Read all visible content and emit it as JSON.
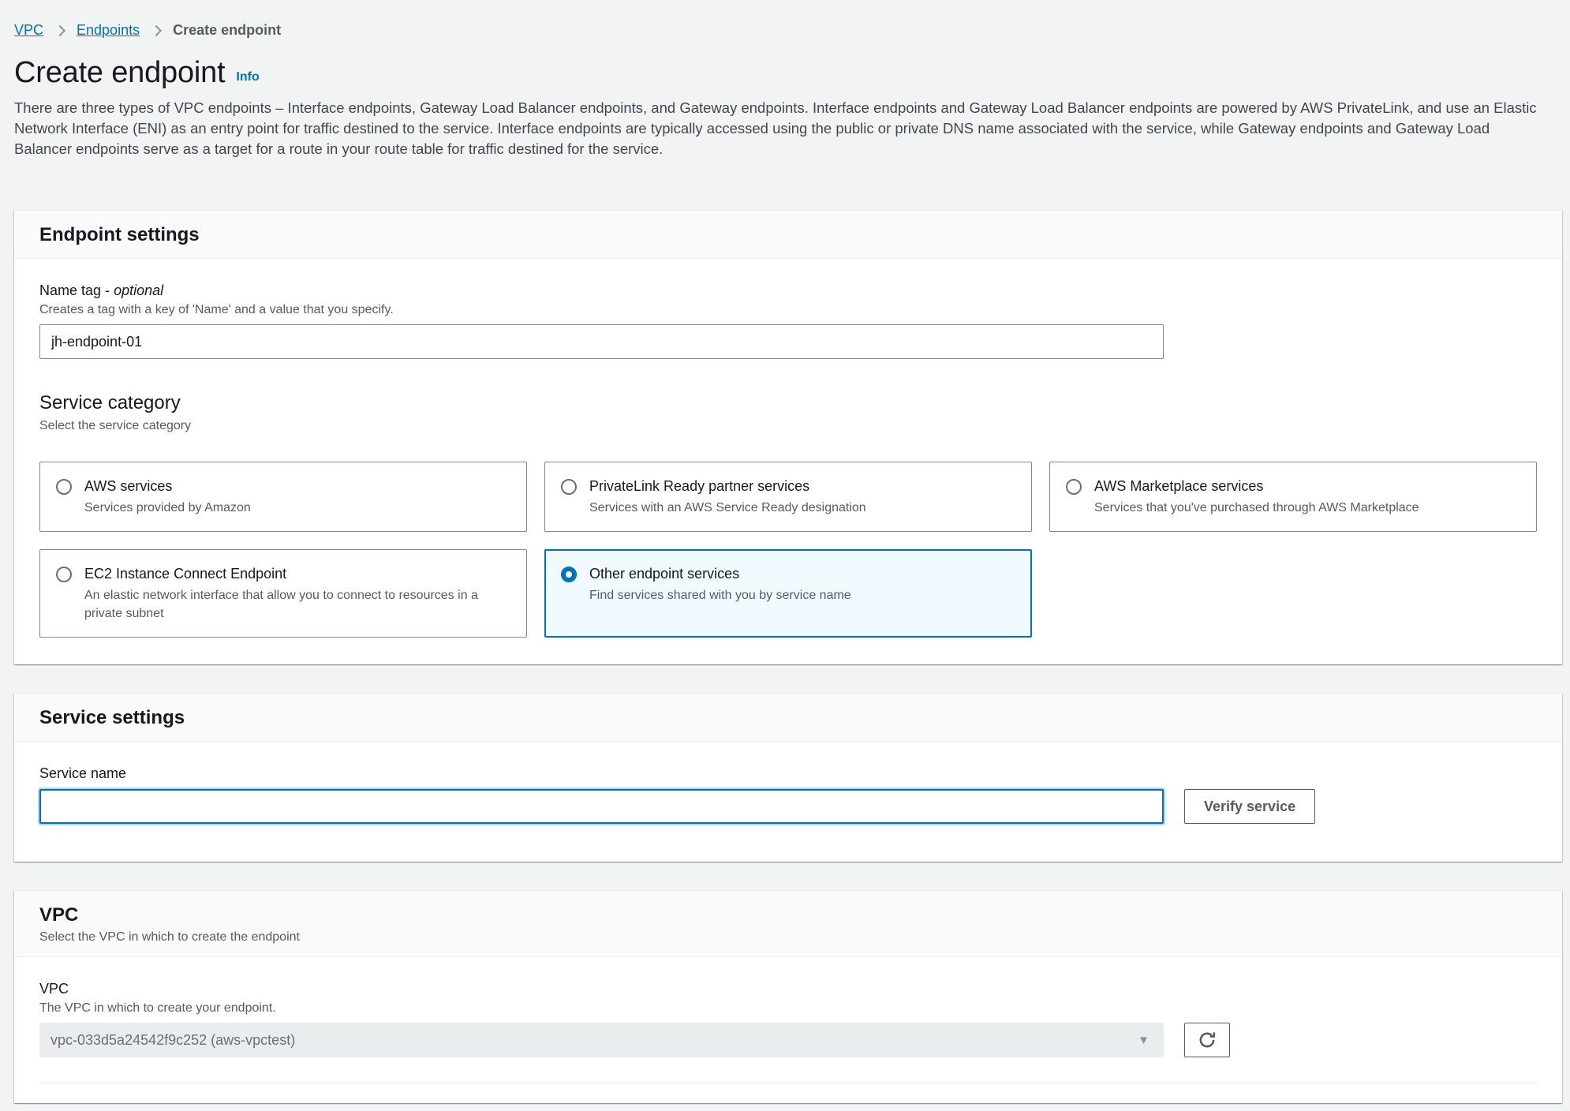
{
  "breadcrumb": {
    "items": [
      "VPC",
      "Endpoints",
      "Create endpoint"
    ]
  },
  "header": {
    "title": "Create endpoint",
    "info_link": "Info",
    "description": "There are three types of VPC endpoints – Interface endpoints, Gateway Load Balancer endpoints, and Gateway endpoints. Interface endpoints and Gateway Load Balancer endpoints are powered by AWS PrivateLink, and use an Elastic Network Interface (ENI) as an entry point for traffic destined to the service. Interface endpoints are typically accessed using the public or private DNS name associated with the service, while Gateway endpoints and Gateway Load Balancer endpoints serve as a target for a route in your route table for traffic destined for the service."
  },
  "colors": {
    "accent_blue": "#0073bb",
    "selected_tile_bg": "#f1faff",
    "page_bg": "#f2f3f3",
    "text_secondary": "#545b64"
  },
  "icons": {
    "breadcrumb_chevron": "chevron-right",
    "dropdown_caret": "▼",
    "refresh": "circular-arrow"
  },
  "endpoint_settings": {
    "title": "Endpoint settings",
    "name_tag": {
      "label": "Name tag -",
      "optional": "optional",
      "help": "Creates a tag with a key of 'Name' and a value that you specify.",
      "value": "jh-endpoint-01"
    },
    "service_category": {
      "title": "Service category",
      "subtitle": "Select the service category",
      "options": [
        {
          "title": "AWS services",
          "description": "Services provided by Amazon",
          "selected": false
        },
        {
          "title": "PrivateLink Ready partner services",
          "description": "Services with an AWS Service Ready designation",
          "selected": false
        },
        {
          "title": "AWS Marketplace services",
          "description": "Services that you've purchased through AWS Marketplace",
          "selected": false
        },
        {
          "title": "EC2 Instance Connect Endpoint",
          "description": "An elastic network interface that allow you to connect to resources in a private subnet",
          "selected": false
        },
        {
          "title": "Other endpoint services",
          "description": "Find services shared with you by service name",
          "selected": true
        }
      ]
    }
  },
  "service_settings": {
    "title": "Service settings",
    "service_name": {
      "label": "Service name",
      "value": ""
    },
    "verify_button": "Verify service"
  },
  "vpc_section": {
    "title": "VPC",
    "subtitle": "Select the VPC in which to create the endpoint",
    "field": {
      "label": "VPC",
      "help": "The VPC in which to create your endpoint.",
      "selected_value": "vpc-033d5a24542f9c252 (aws-vpctest)"
    }
  }
}
